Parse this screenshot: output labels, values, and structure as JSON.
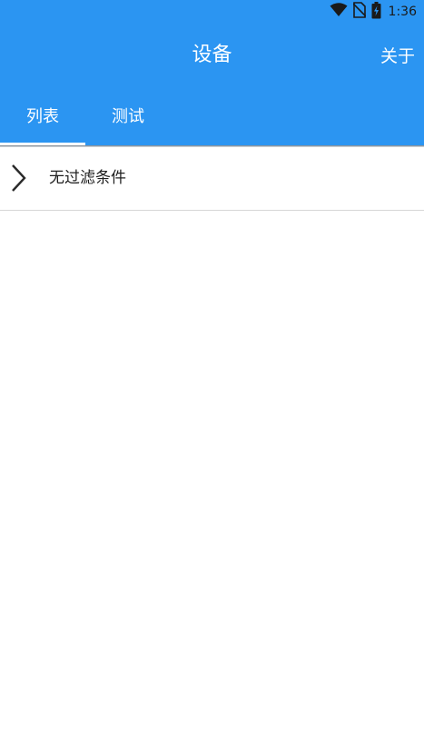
{
  "status_bar": {
    "time": "1:36",
    "icons": [
      "wifi-icon",
      "no-sim-icon",
      "battery-charging-icon"
    ]
  },
  "toolbar": {
    "title": "设备",
    "about_label": "关于"
  },
  "tabs": [
    {
      "label": "列表",
      "selected": true
    },
    {
      "label": "测试",
      "selected": false
    }
  ],
  "filter_row": {
    "label": "无过滤条件",
    "icon": "chevron-right-icon"
  },
  "colors": {
    "accent": "#2b95f2",
    "text_on_accent": "#ffffff",
    "body_text": "#1f1f1f",
    "divider": "#d6d6d6"
  }
}
